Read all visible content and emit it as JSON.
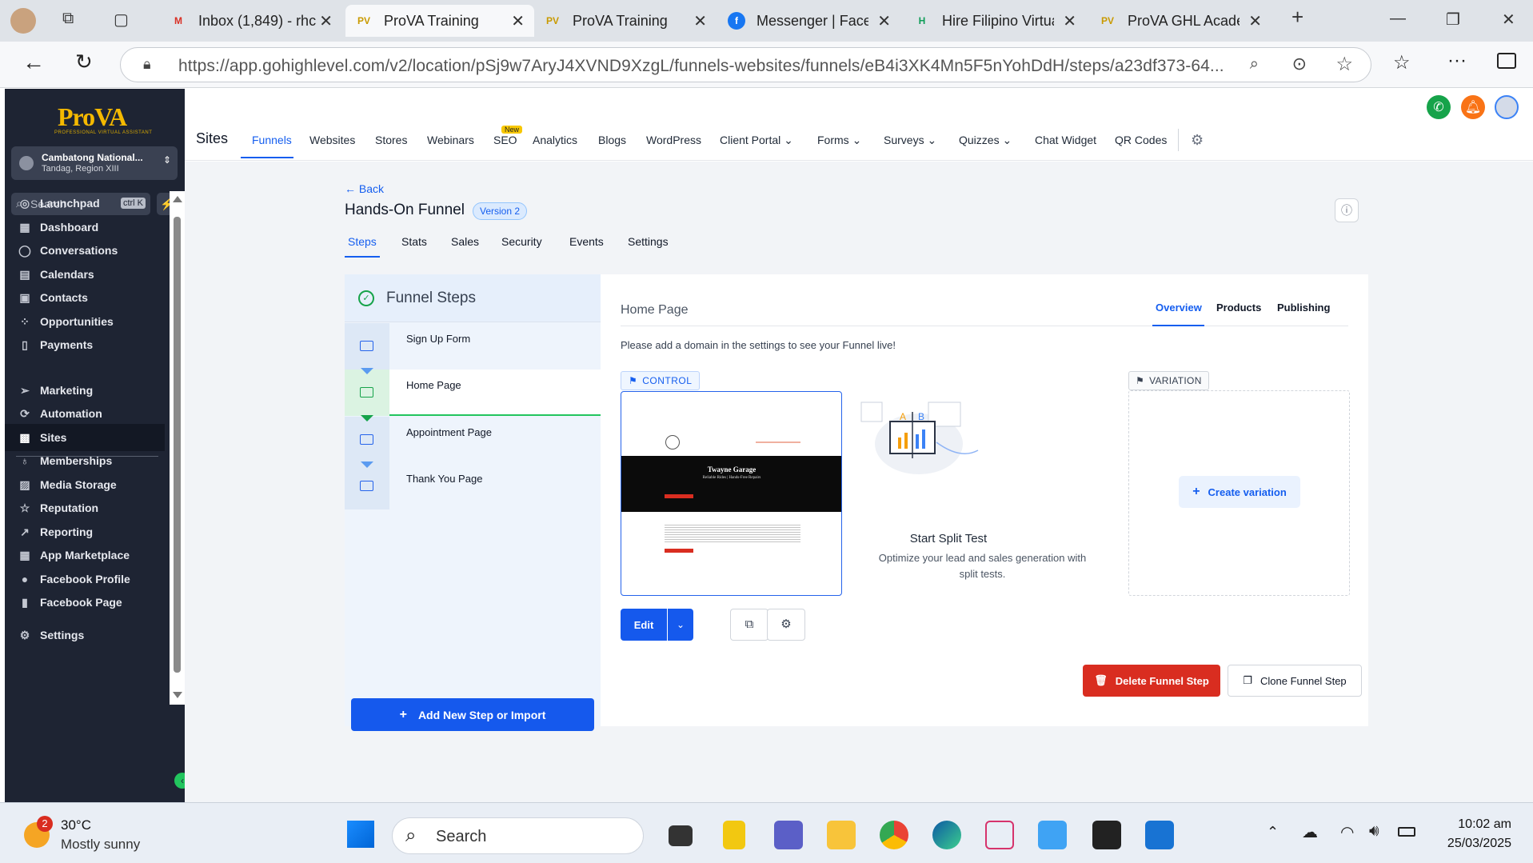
{
  "browser": {
    "tabs": [
      {
        "title": "Inbox (1,849) - rhc",
        "favicon": "M"
      },
      {
        "title": "ProVA Training",
        "favicon": "PV"
      },
      {
        "title": "ProVA Training",
        "favicon": "PV"
      },
      {
        "title": "Messenger | Facebook",
        "favicon": "f"
      },
      {
        "title": "Hire Filipino Virtual",
        "favicon": "H"
      },
      {
        "title": "ProVA GHL Academy",
        "favicon": "PV"
      }
    ],
    "url": "https://app.gohighlevel.com/v2/location/pSj9w7AryJ4XVND9XzgL/funnels-websites/funnels/eB4i3XK4Mn5F5nYohDdH/steps/a23df373-64..."
  },
  "sidebar": {
    "logo": "ProVA",
    "logo_sub": "PROFESSIONAL VIRTUAL ASSISTANT",
    "account_name": "Cambatong National...",
    "account_sub": "Tandag, Region XIII",
    "search_label": "Search",
    "search_shortcut": "ctrl K",
    "items": [
      {
        "label": "Launchpad",
        "icon": "rocket-icon"
      },
      {
        "label": "Dashboard",
        "icon": "grid-icon"
      },
      {
        "label": "Conversations",
        "icon": "chat-icon"
      },
      {
        "label": "Calendars",
        "icon": "calendar-icon"
      },
      {
        "label": "Contacts",
        "icon": "contacts-icon"
      },
      {
        "label": "Opportunities",
        "icon": "opportunities-icon"
      },
      {
        "label": "Payments",
        "icon": "payments-icon"
      },
      {
        "label": "Marketing",
        "icon": "send-icon"
      },
      {
        "label": "Automation",
        "icon": "automation-icon"
      },
      {
        "label": "Sites",
        "icon": "sites-icon"
      },
      {
        "label": "Memberships",
        "icon": "badge-icon"
      },
      {
        "label": "Media Storage",
        "icon": "image-icon"
      },
      {
        "label": "Reputation",
        "icon": "star-icon"
      },
      {
        "label": "Reporting",
        "icon": "trend-icon"
      },
      {
        "label": "App Marketplace",
        "icon": "apps-icon"
      },
      {
        "label": "Facebook Profile",
        "icon": "user-icon"
      },
      {
        "label": "Facebook Page",
        "icon": "facebook-icon"
      },
      {
        "label": "Settings",
        "icon": "gear-icon"
      }
    ]
  },
  "topnav": {
    "title": "Sites",
    "items": [
      "Funnels",
      "Websites",
      "Stores",
      "Webinars",
      "SEO",
      "Analytics",
      "Blogs",
      "WordPress",
      "Client Portal",
      "Forms",
      "Surveys",
      "Quizzes",
      "Chat Widget",
      "QR Codes"
    ],
    "new_badge": "New"
  },
  "funnel": {
    "back": "Back",
    "title": "Hands-On Funnel",
    "version": "Version 2",
    "tabs": [
      "Steps",
      "Stats",
      "Sales",
      "Security",
      "Events",
      "Settings"
    ],
    "steps_heading": "Funnel Steps",
    "steps": [
      "Sign Up Form",
      "Home Page",
      "Appointment Page",
      "Thank You Page"
    ],
    "add_step": "Add New Step or Import"
  },
  "detail": {
    "title": "Home Page",
    "tabs": [
      "Overview",
      "Products",
      "Publishing"
    ],
    "domain_note": "Please add a domain in the settings to see your Funnel live!",
    "control_label": "CONTROL",
    "preview_title": "Twayne Garage",
    "preview_sub": "Reliable Rides | Hands-Free Repairs",
    "edit_label": "Edit",
    "split_title": "Start Split Test",
    "split_desc": "Optimize your lead and sales generation with split tests.",
    "variation_label": "VARIATION",
    "create_variation": "Create variation",
    "delete_label": "Delete Funnel Step",
    "clone_label": "Clone Funnel Step"
  },
  "taskbar": {
    "weather_badge": "2",
    "temp": "30°C",
    "weather": "Mostly sunny",
    "search_label": "Search",
    "time": "10:02 am",
    "date": "25/03/2025"
  },
  "colors": {
    "primary": "#155eef",
    "sidebar": "#1e2433",
    "danger": "#d92d20",
    "success": "#16a34a"
  }
}
